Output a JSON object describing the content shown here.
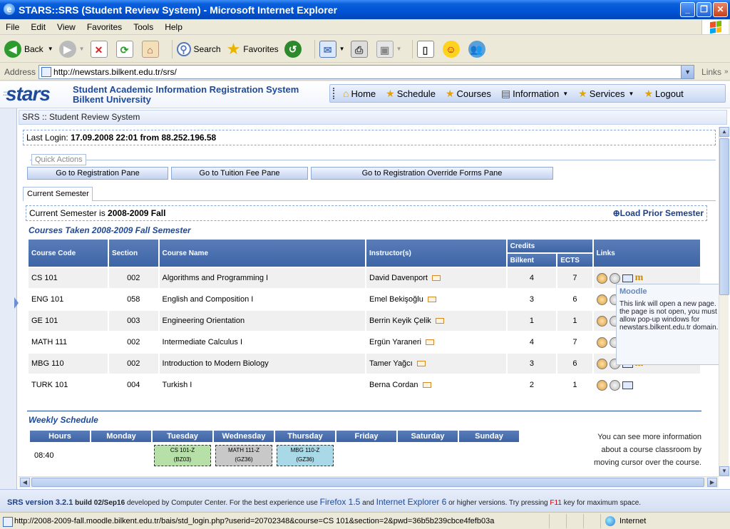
{
  "window": {
    "title": "STARS::SRS (Student Review System) - Microsoft Internet Explorer",
    "controls": [
      "_",
      "❐",
      "✕"
    ]
  },
  "menu": [
    "File",
    "Edit",
    "View",
    "Favorites",
    "Tools",
    "Help"
  ],
  "toolbar": {
    "back": "Back",
    "search": "Search",
    "favorites": "Favorites"
  },
  "address": {
    "label": "Address",
    "url": "http://newstars.bilkent.edu.tr/srs/",
    "links": "Links"
  },
  "header": {
    "logo": "stars",
    "system_name": "Student Academic Information Registration System",
    "university": "Bilkent University",
    "nav": [
      "Home",
      "Schedule",
      "Courses",
      "Information",
      "Services",
      "Logout"
    ]
  },
  "breadcrumb": "SRS :: Student Review System",
  "last_login": {
    "label": "Last Login:",
    "value": "17.09.2008 22:01 from 88.252.196.58"
  },
  "quick_actions": {
    "legend": "Quick Actions",
    "buttons": [
      "Go to Registration Pane",
      "Go to Tuition Fee Pane",
      "Go to Registration Override Forms Pane"
    ]
  },
  "current_semester": {
    "tab": "Current Semester",
    "label": "Current Semester is",
    "value": "2008-2009 Fall",
    "load_prior": "Load Prior Semester"
  },
  "courses": {
    "title": "Courses Taken 2008-2009 Fall Semester",
    "headers": {
      "code": "Course Code",
      "section": "Section",
      "name": "Course Name",
      "instructor": "Instructor(s)",
      "credits": "Credits",
      "bilkent": "Bilkent",
      "ects": "ECTS",
      "links": "Links"
    },
    "rows": [
      {
        "code": "CS 101",
        "section": "002",
        "name": "Algorithms and Programming I",
        "instructor": "David Davenport",
        "bilkent": "4",
        "ects": "7"
      },
      {
        "code": "ENG 101",
        "section": "058",
        "name": "English and Composition I",
        "instructor": "Emel Bekişoğlu",
        "bilkent": "3",
        "ects": "6"
      },
      {
        "code": "GE 101",
        "section": "003",
        "name": "Engineering Orientation",
        "instructor": "Berrin Keyik Çelik",
        "bilkent": "1",
        "ects": "1"
      },
      {
        "code": "MATH 111",
        "section": "002",
        "name": "Intermediate Calculus I",
        "instructor": "Ergün Yaraneri",
        "bilkent": "4",
        "ects": "7"
      },
      {
        "code": "MBG 110",
        "section": "002",
        "name": "Introduction to Modern Biology",
        "instructor": "Tamer Yağcı",
        "bilkent": "3",
        "ects": "6"
      },
      {
        "code": "TURK 101",
        "section": "004",
        "name": "Turkish I",
        "instructor": "Berna Cordan",
        "bilkent": "2",
        "ects": "1"
      }
    ]
  },
  "tooltip": {
    "title": "Moodle",
    "text": "This link will open a new page. If the page is not open, you must allow pop-up windows for newstars.bilkent.edu.tr domain."
  },
  "schedule": {
    "title": "Weekly Schedule",
    "headers": [
      "Hours",
      "Monday",
      "Tuesday",
      "Wednesday",
      "Thursday",
      "Friday",
      "Saturday",
      "Sunday"
    ],
    "time": "08:40",
    "slots": [
      {
        "course": "CS 101-Z",
        "room": "(BZ03)",
        "color": "#b7e0a9"
      },
      {
        "course": "MATH 111-Z",
        "room": "(GZ36)",
        "color": "#c8c8c8"
      },
      {
        "course": "MBG 110-Z",
        "room": "(GZ36)",
        "color": "#a9d8e6"
      }
    ],
    "note": "You can see more information about a course classroom by moving cursor over the course."
  },
  "footer": {
    "version": "SRS version 3.2.1",
    "build_label": "build",
    "build": "02/Sep16",
    "developed": "developed by Computer Center.  For the best experience use",
    "firefox": "Firefox 1.5",
    "and": "and",
    "ie": "Internet Explorer 6",
    "or_higher": "or higher versions.  Try pressing",
    "f11": "F11",
    "max_space": "key for maximum space."
  },
  "status": {
    "url": "http://2008-2009-fall.moodle.bilkent.edu.tr/bais/std_login.php?userid=20702348&course=CS 101&section=2&pwd=36b5b239cbce4fefb03a",
    "zone": "Internet"
  }
}
